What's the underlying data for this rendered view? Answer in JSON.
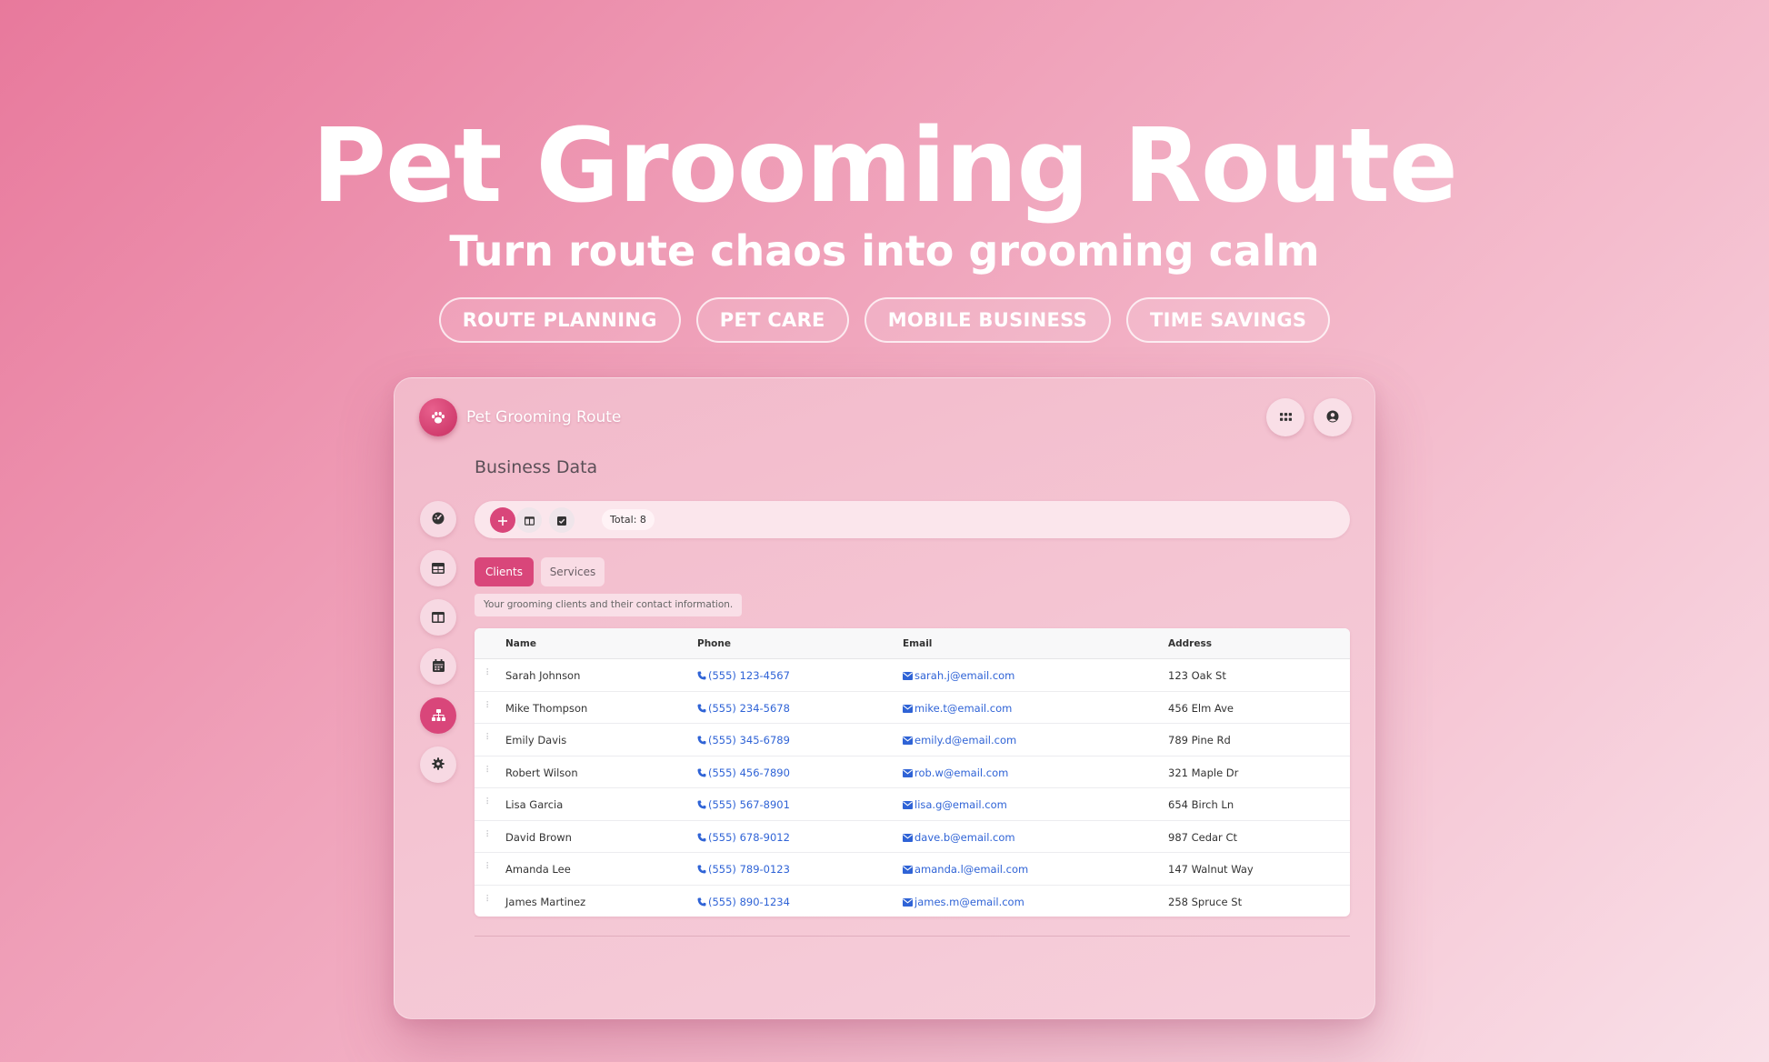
{
  "hero": {
    "title": "Pet Grooming Route",
    "subtitle": "Turn route chaos into grooming calm",
    "tags": [
      "ROUTE PLANNING",
      "PET CARE",
      "MOBILE BUSINESS",
      "TIME SAVINGS"
    ]
  },
  "app": {
    "title": "Pet Grooming Route",
    "logo_icon": "paw-icon",
    "page_heading": "Business Data",
    "header_actions": [
      "apps-grid-icon",
      "user-account-icon"
    ],
    "sidebar": [
      {
        "icon": "dashboard-gauge-icon",
        "active": false
      },
      {
        "icon": "table-icon",
        "active": false
      },
      {
        "icon": "columns-icon",
        "active": false
      },
      {
        "icon": "calendar-icon",
        "active": false
      },
      {
        "icon": "sitemap-icon",
        "active": true
      },
      {
        "icon": "settings-gear-icon",
        "active": false
      }
    ],
    "toolbar": {
      "buttons": [
        "add-icon",
        "columns-icon",
        "checkbox-icon"
      ],
      "total_label": "Total:",
      "total_value": "8"
    },
    "tabs": [
      {
        "label": "Clients",
        "active": true
      },
      {
        "label": "Services",
        "active": false
      }
    ],
    "description": "Your grooming clients and their contact information.",
    "table": {
      "columns": [
        "Name",
        "Phone",
        "Email",
        "Address"
      ],
      "rows": [
        {
          "name": "Sarah Johnson",
          "phone": "(555) 123-4567",
          "email": "sarah.j@email.com",
          "address": "123 Oak St"
        },
        {
          "name": "Mike Thompson",
          "phone": "(555) 234-5678",
          "email": "mike.t@email.com",
          "address": "456 Elm Ave"
        },
        {
          "name": "Emily Davis",
          "phone": "(555) 345-6789",
          "email": "emily.d@email.com",
          "address": "789 Pine Rd"
        },
        {
          "name": "Robert Wilson",
          "phone": "(555) 456-7890",
          "email": "rob.w@email.com",
          "address": "321 Maple Dr"
        },
        {
          "name": "Lisa Garcia",
          "phone": "(555) 567-8901",
          "email": "lisa.g@email.com",
          "address": "654 Birch Ln"
        },
        {
          "name": "David Brown",
          "phone": "(555) 678-9012",
          "email": "dave.b@email.com",
          "address": "987 Cedar Ct"
        },
        {
          "name": "Amanda Lee",
          "phone": "(555) 789-0123",
          "email": "amanda.l@email.com",
          "address": "147 Walnut Way"
        },
        {
          "name": "James Martinez",
          "phone": "(555) 890-1234",
          "email": "james.m@email.com",
          "address": "258 Spruce St"
        }
      ]
    },
    "colors": {
      "accent": "#d9467a",
      "link": "#2f63d6"
    }
  }
}
